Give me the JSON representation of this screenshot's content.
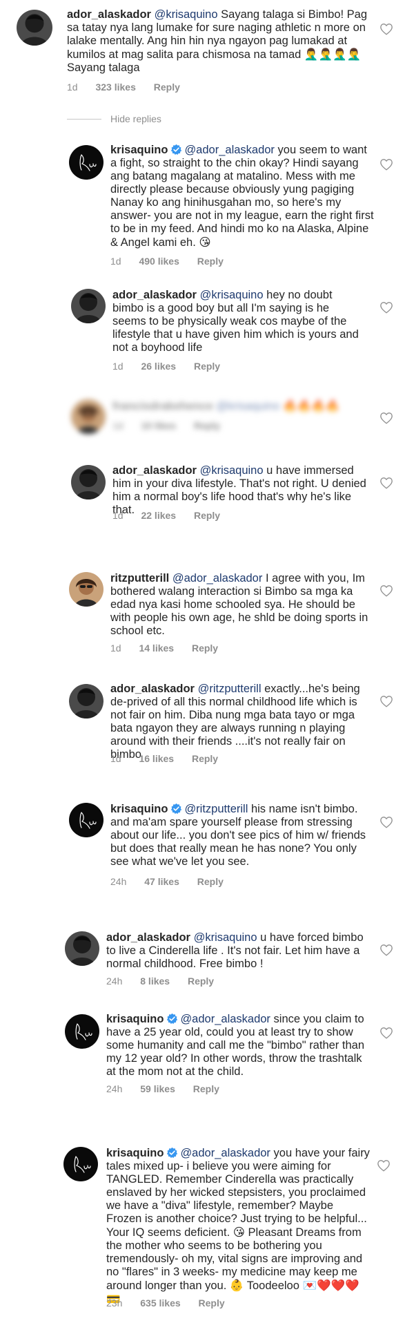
{
  "hide_replies_label": "Hide replies",
  "comments": [
    {
      "username": "ador_alaskador",
      "mention": "@krisaquino",
      "text": "Sayang talaga si Bimbo! Pag sa tatay nya lang lumake for sure naging athletic n more on lalake mentally. Ang hin hin nya ngayon pag lumakad at kumilos at mag salita para chismosa na tamad",
      "text_end": "Sayang talaga",
      "emoji": "🤦‍♂️🤦‍♂️🤦‍♂️🤦‍♂️",
      "time": "1d",
      "likes": "323 likes",
      "reply": "Reply"
    },
    {
      "username": "krisaquino",
      "mention": "@ador_alaskador",
      "text": "you seem to want a fight, so straight to the chin okay? Hindi sayang ang batang magalang at matalino. Mess with me directly please because obviously yung pagiging Nanay ko ang hinihusgahan mo, so here's my answer- you are not in my league, earn the right first to be in my feed. And hindi mo ko na Alaska, Alpine & Angel kami eh.",
      "emoji": "😘",
      "time": "1d",
      "likes": "490 likes",
      "reply": "Reply"
    },
    {
      "username": "ador_alaskador",
      "mention": "@krisaquino",
      "text": "hey no doubt bimbo is a good boy but all I'm saying is he seems to be physically weak cos maybe of the lifestyle that u have given him which is yours and not a boyhood life",
      "time": "1d",
      "likes": "26 likes",
      "reply": "Reply"
    },
    {
      "username": "francisdrakehence",
      "mention": "@krisaquino",
      "emoji": "🔥🔥🔥🔥",
      "time": "1d",
      "likes": "10 likes",
      "reply": "Reply"
    },
    {
      "username": "ador_alaskador",
      "mention": "@krisaquino",
      "text": "u have immersed him in your diva lifestyle. That's not right. U denied him a normal boy's life hood that's why he's like that.",
      "time": "1d",
      "likes": "22 likes",
      "reply": "Reply"
    },
    {
      "username": "ritzputterill",
      "mention": "@ador_alaskador",
      "text": "I agree with you, Im bothered walang interaction si Bimbo sa mga ka edad nya kasi home schooled sya. He should be with people his own age, he shld be doing sports in school etc.",
      "time": "1d",
      "likes": "14 likes",
      "reply": "Reply"
    },
    {
      "username": "ador_alaskador",
      "mention": "@ritzputterill",
      "text": "exactly...he's being de-prived of all this normal childhood life which is not fair on him. Diba nung mga bata tayo or mga bata ngayon they are always running n playing around with their friends ....it's not really fair on bimbo",
      "time": "1d",
      "likes": "16 likes",
      "reply": "Reply"
    },
    {
      "username": "krisaquino",
      "mention": "@ritzputterill",
      "text": "his name isn't bimbo. and ma'am spare yourself please from stressing about our life... you don't see pics of him w/ friends but does that really mean he has none? You only see what we've let you see.",
      "time": "24h",
      "likes": "47 likes",
      "reply": "Reply"
    },
    {
      "username": "ador_alaskador",
      "mention": "@krisaquino",
      "text": "u have forced bimbo to live a Cinderella life . It's not fair. Let him have a normal childhood. Free bimbo !",
      "time": "24h",
      "likes": "8 likes",
      "reply": "Reply"
    },
    {
      "username": "krisaquino",
      "mention": "@ador_alaskador",
      "text": "since you claim to have a 25 year old, could you at least try to show some humanity and call me the \"bimbo\" rather than my 12 year old? In other words, throw the trashtalk at the mom not at the child.",
      "time": "24h",
      "likes": "59 likes",
      "reply": "Reply"
    },
    {
      "username": "krisaquino",
      "mention": "@ador_alaskador",
      "text": "you have your fairy tales mixed up- i believe you were aiming for TANGLED. Remember Cinderella was practically enslaved by her wicked stepsisters, you proclaimed we have a \"diva\" lifestyle, remember? Maybe Frozen is another choice? Just trying to be helpful... Your IQ seems deficient.",
      "text_mid": "Pleasant Dreams from the mother who seems to be bothering you tremendously- oh my, vital signs are improving and no \"flares\" in 3 weeks- my medicine may keep me around longer than you.",
      "text_end": "Toodeeloo",
      "emoji": "😘",
      "emoji_end": "👶",
      "emoji_tail": "💌❤️❤️❤️💳",
      "time": "23h",
      "likes": "635 likes",
      "reply": "Reply"
    }
  ],
  "colors": {
    "verified": "#3897f0",
    "mention": "#1e3a6e",
    "meta": "#8e8e8e"
  },
  "icons": [
    "heart-outline-icon",
    "verified-badge-icon"
  ]
}
